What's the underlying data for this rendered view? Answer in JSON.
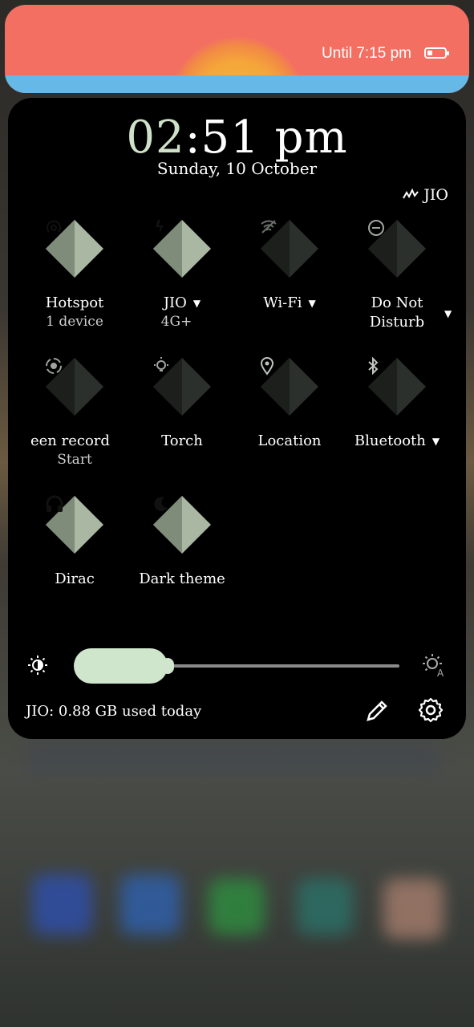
{
  "status_banner": {
    "battery_text": "Until 7:15 pm",
    "battery_icon": "battery-low-icon"
  },
  "header": {
    "time_hours": "02",
    "time_rest": ":51 pm",
    "date": "Sunday, 10 October",
    "carrier": "JIO",
    "signal_icon": "signal-icon"
  },
  "tiles": [
    {
      "label": "Hotspot",
      "sub": "1 device",
      "icon": "hotspot-icon",
      "active": true
    },
    {
      "label": "JIO",
      "sub": "4G+",
      "icon": "mobile-data-icon",
      "active": true,
      "has_caret": true
    },
    {
      "label": "Wi-Fi",
      "sub": "",
      "icon": "wifi-off-icon",
      "active": false,
      "has_caret": true
    },
    {
      "label": "Do Not\nDisturb",
      "sub": "",
      "icon": "do-not-disturb-icon",
      "active": false,
      "has_caret": true
    },
    {
      "label": "een record",
      "sub": "Start",
      "icon": "screen-record-icon",
      "active": false
    },
    {
      "label": "Torch",
      "sub": "",
      "icon": "flashlight-icon",
      "active": false
    },
    {
      "label": "Location",
      "sub": "",
      "icon": "location-icon",
      "active": false
    },
    {
      "label": "Bluetooth",
      "sub": "",
      "icon": "bluetooth-icon",
      "active": false,
      "has_caret": true
    },
    {
      "label": "Dirac",
      "sub": "",
      "icon": "headphones-icon",
      "active": true
    },
    {
      "label": "Dark theme",
      "sub": "",
      "icon": "dark-theme-icon",
      "active": true
    }
  ],
  "brightness": {
    "level": 0.24,
    "low_icon": "brightness-low-icon",
    "auto_icon": "brightness-auto-icon"
  },
  "footer": {
    "usage": "JIO: 0.88 GB used today",
    "edit_icon": "edit-pencil-icon",
    "settings_icon": "gear-icon"
  },
  "colors": {
    "accent": "#cfe6cd",
    "tile_active": "#aab8a3",
    "tile_inactive": "#2c302c",
    "banner": "#f36f62",
    "banner_strip": "#66b8e6"
  }
}
